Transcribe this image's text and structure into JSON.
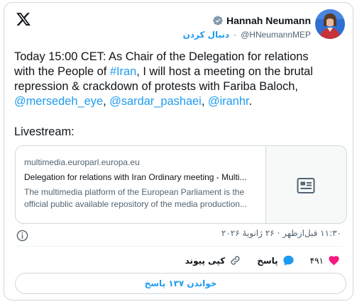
{
  "author": {
    "name": "Hannah Neumann",
    "handle": "@HNeumannMEP",
    "separator": "·",
    "follow_label": "دنبال کردن"
  },
  "tweet": {
    "line1": "Today 15:00 CET: As Chair of the Delegation for relations",
    "line2_a": "with the People of ",
    "line2_hashtag": "#Iran",
    "line2_b": ", I will host a meeting on the brutal",
    "line3": "repression & crackdown of protests with Fariba Baloch,",
    "mention1": "@mersedeh_eye",
    "comma1": ", ",
    "mention2": "@sardar_pashaei",
    "comma2": ", ",
    "mention3": "@iranhr",
    "period": ".",
    "livestream": "Livestream:"
  },
  "link_card": {
    "domain": "multimedia.europarl.europa.eu",
    "title": "Delegation for relations with Iran Ordinary meeting - Multi...",
    "desc_line1": "The multimedia platform of the European Parliament is the",
    "desc_line2": "official public available repository of the media production...",
    "thumb_icon": "newspaper-icon"
  },
  "meta": {
    "timestamp": "۱۱:۳۰ قبل‌ازظهر · ۲۶ ژانویهٔ ۲۰۲۶"
  },
  "actions": {
    "like_count": "۴۹۱",
    "reply_label": "پاسخ",
    "copy_label": "کپی پیوند"
  },
  "read_replies_label": "خواندن ۱۳۷ پاسخ",
  "colors": {
    "accent": "#1d9bf0",
    "like": "#f91880",
    "text": "#0f1419",
    "muted": "#536471",
    "border": "#cfd9de"
  }
}
